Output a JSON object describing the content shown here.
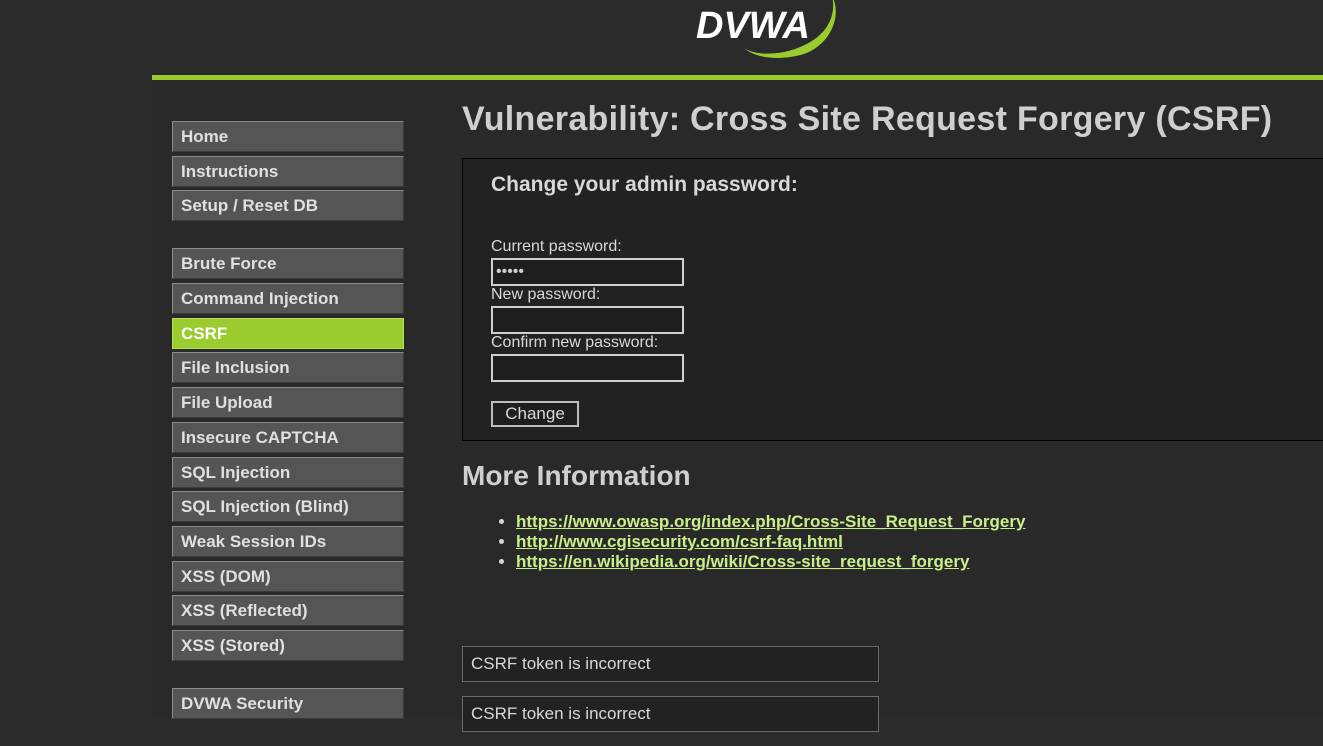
{
  "app": {
    "logo_text": "DVWA",
    "accent_color": "#9acc2f"
  },
  "sidebar": {
    "groups": [
      [
        {
          "label": "Home"
        },
        {
          "label": "Instructions"
        },
        {
          "label": "Setup / Reset DB"
        }
      ],
      [
        {
          "label": "Brute Force"
        },
        {
          "label": "Command Injection"
        },
        {
          "label": "CSRF",
          "active": true
        },
        {
          "label": "File Inclusion"
        },
        {
          "label": "File Upload"
        },
        {
          "label": "Insecure CAPTCHA"
        },
        {
          "label": "SQL Injection"
        },
        {
          "label": "SQL Injection (Blind)"
        },
        {
          "label": "Weak Session IDs"
        },
        {
          "label": "XSS (DOM)"
        },
        {
          "label": "XSS (Reflected)"
        },
        {
          "label": "XSS (Stored)"
        }
      ],
      [
        {
          "label": "DVWA Security"
        }
      ]
    ]
  },
  "main": {
    "title": "Vulnerability: Cross Site Request Forgery (CSRF)",
    "form": {
      "title": "Change your admin password:",
      "current_label": "Current password:",
      "current_value": "•••••",
      "new_label": "New password:",
      "new_value": "",
      "confirm_label": "Confirm new password:",
      "confirm_value": "",
      "submit_label": "Change"
    },
    "more_info": {
      "title": "More Information",
      "links": [
        "https://www.owasp.org/index.php/Cross-Site_Request_Forgery",
        "http://www.cgisecurity.com/csrf-faq.html",
        "https://en.wikipedia.org/wiki/Cross-site_request_forgery"
      ]
    },
    "messages": [
      "CSRF token is incorrect",
      "CSRF token is incorrect"
    ]
  }
}
